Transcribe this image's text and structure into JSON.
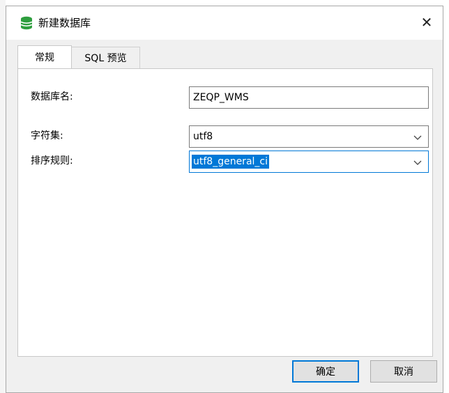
{
  "window": {
    "title": "新建数据库",
    "close_glyph": "✕",
    "icon": "database-icon"
  },
  "tabs": [
    {
      "label": "常规",
      "active": true
    },
    {
      "label": "SQL 预览",
      "active": false
    }
  ],
  "form": {
    "db_name": {
      "label": "数据库名:",
      "value": "ZEQP_WMS"
    },
    "charset": {
      "label": "字符集:",
      "value": "utf8"
    },
    "collation": {
      "label": "排序规则:",
      "value": "utf8_general_ci"
    }
  },
  "buttons": {
    "ok": "确定",
    "cancel": "取消"
  },
  "colors": {
    "accent": "#0078d7",
    "db_icon": "#2e9e3e"
  }
}
